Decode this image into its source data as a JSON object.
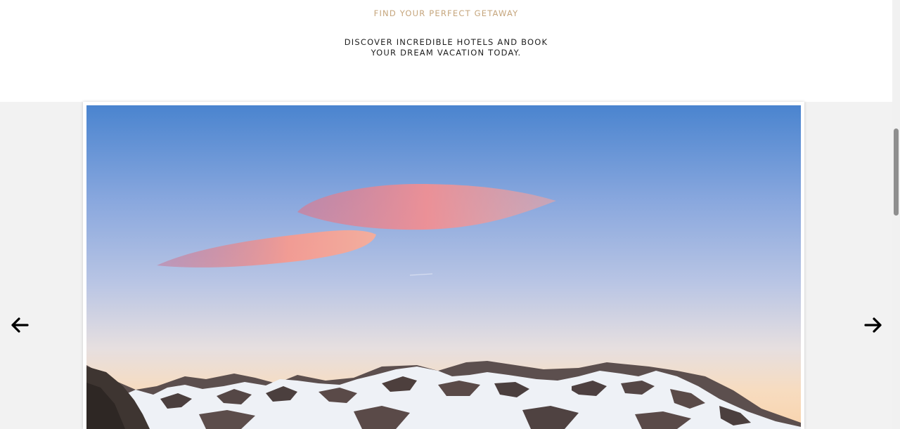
{
  "header": {
    "eyebrow": "FIND YOUR PERFECT GETAWAY",
    "tagline_line1": "DISCOVER INCREDIBLE HOTELS AND BOOK",
    "tagline_line2": "YOUR DREAM VACATION TODAY."
  },
  "carousel": {
    "prev_icon": "arrow-left-icon",
    "next_icon": "arrow-right-icon",
    "slide_image": "mountain-sunset-photo"
  },
  "colors": {
    "accent": "#c5a57c",
    "text": "#1e1e1e",
    "carousel_background": "#f2f2f2"
  }
}
